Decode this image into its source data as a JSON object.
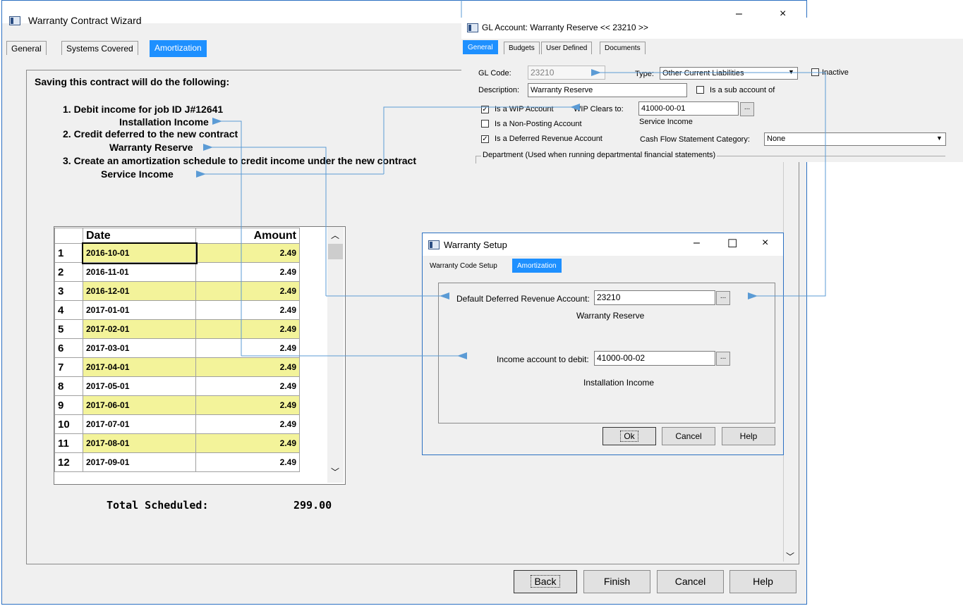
{
  "main": {
    "title": "Warranty Contract Wizard",
    "tabs": [
      {
        "label": "General"
      },
      {
        "label": "Systems Covered"
      },
      {
        "label": "Amortization"
      }
    ],
    "heading": "Saving this contract will do the following:",
    "steps": [
      {
        "line": "1. Debit income for job ID J#12641",
        "account": "Installation Income"
      },
      {
        "line": "2. Credit deferred to the new contract",
        "account": "Warranty Reserve"
      },
      {
        "line": "3. Create an amortization schedule to credit income under the new contract",
        "account": "Service Income"
      }
    ],
    "grid": {
      "headers": {
        "date": "Date",
        "amount": "Amount"
      },
      "rows": [
        {
          "n": "1",
          "date": "2016-10-01",
          "amount": "2.49"
        },
        {
          "n": "2",
          "date": "2016-11-01",
          "amount": "2.49"
        },
        {
          "n": "3",
          "date": "2016-12-01",
          "amount": "2.49"
        },
        {
          "n": "4",
          "date": "2017-01-01",
          "amount": "2.49"
        },
        {
          "n": "5",
          "date": "2017-02-01",
          "amount": "2.49"
        },
        {
          "n": "6",
          "date": "2017-03-01",
          "amount": "2.49"
        },
        {
          "n": "7",
          "date": "2017-04-01",
          "amount": "2.49"
        },
        {
          "n": "8",
          "date": "2017-05-01",
          "amount": "2.49"
        },
        {
          "n": "9",
          "date": "2017-06-01",
          "amount": "2.49"
        },
        {
          "n": "10",
          "date": "2017-07-01",
          "amount": "2.49"
        },
        {
          "n": "11",
          "date": "2017-08-01",
          "amount": "2.49"
        },
        {
          "n": "12",
          "date": "2017-09-01",
          "amount": "2.49"
        }
      ]
    },
    "total_label": "Total Scheduled:",
    "total_value": "299.00",
    "buttons": {
      "back": "Back",
      "finish": "Finish",
      "cancel": "Cancel",
      "help": "Help"
    }
  },
  "gl": {
    "title": "GL Account: Warranty Reserve << 23210 >>",
    "tabs": [
      {
        "label": "General"
      },
      {
        "label": "Budgets"
      },
      {
        "label": "User Defined"
      },
      {
        "label": "Documents"
      }
    ],
    "gl_code_label": "GL Code:",
    "gl_code_value": "23210",
    "type_label": "Type:",
    "type_value": "Other Current Liabilities",
    "inactive_label": "Inactive",
    "description_label": "Description:",
    "description_value": "Warranty Reserve",
    "sub_account_label": "Is a sub account of",
    "wip_label": "Is a WIP Account",
    "wip_clears_label": "WIP Clears to:",
    "wip_clears_value": "41000-00-01",
    "wip_clears_desc": "Service Income",
    "non_posting_label": "Is a Non-Posting Account",
    "deferred_label": "Is a Deferred Revenue Account",
    "cash_flow_label": "Cash Flow Statement Category:",
    "cash_flow_value": "None",
    "department_label": "Department (Used when running departmental financial statements)"
  },
  "setup": {
    "title": "Warranty Setup",
    "tabs": [
      {
        "label": "Warranty Code Setup"
      },
      {
        "label": "Amortization"
      }
    ],
    "deferred_label": "Default Deferred Revenue Account:",
    "deferred_value": "23210",
    "deferred_desc": "Warranty Reserve",
    "income_label": "Income account to debit:",
    "income_value": "41000-00-02",
    "income_desc": "Installation Income",
    "buttons": {
      "ok": "Ok",
      "cancel": "Cancel",
      "help": "Help"
    }
  },
  "colors": {
    "accent": "#1e90ff",
    "arrow": "#5b9bd5",
    "highlight_row": "#f3f39a"
  }
}
